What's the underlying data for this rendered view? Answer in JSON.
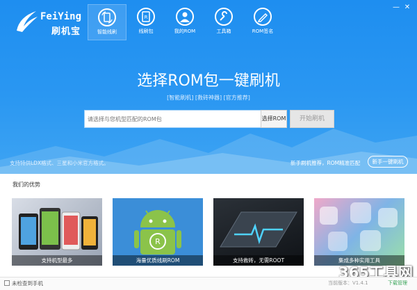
{
  "app": {
    "brand_en": "FeiYing",
    "brand_cn": "刷机宝",
    "colors": {
      "header_blue": "#2a97f2",
      "accent_green": "#3ba55a"
    }
  },
  "nav": [
    {
      "label": "智能线刷",
      "icon": "refresh-phone-icon",
      "active": true
    },
    {
      "label": "线刷包",
      "icon": "rom-package-icon",
      "active": false
    },
    {
      "label": "我的ROM",
      "icon": "user-icon",
      "active": false
    },
    {
      "label": "工具箱",
      "icon": "wrench-icon",
      "active": false
    },
    {
      "label": "ROM签名",
      "icon": "pen-icon",
      "active": false
    }
  ],
  "window_buttons": {
    "minimize": "—",
    "close": "✕"
  },
  "hero": {
    "headline": "选择ROM包一键刷机",
    "tags": "[智能刷机] [救砖神器] [官方推荐]",
    "search_placeholder": "请选择与您机型匹配的ROM包",
    "select_label": "选择ROM",
    "start_label": "开始刷机",
    "support_note": "支持特供LDX格式、三星和小米官方格式。",
    "recommend_note": "新手刷机推荐，ROM精准匹配",
    "recommend_button": "新手一键刷机"
  },
  "advantages": {
    "title": "我们的优势",
    "cards": [
      {
        "caption": "支持机型最多"
      },
      {
        "caption": "海量优质线刷ROM"
      },
      {
        "caption": "支持救砖，无需ROOT"
      },
      {
        "caption": "集成多种实用工具"
      }
    ]
  },
  "status": {
    "left": "未检查到手机",
    "version": "当前版本：V1.4.1",
    "download": "下载管理"
  },
  "watermark": "365工具网"
}
